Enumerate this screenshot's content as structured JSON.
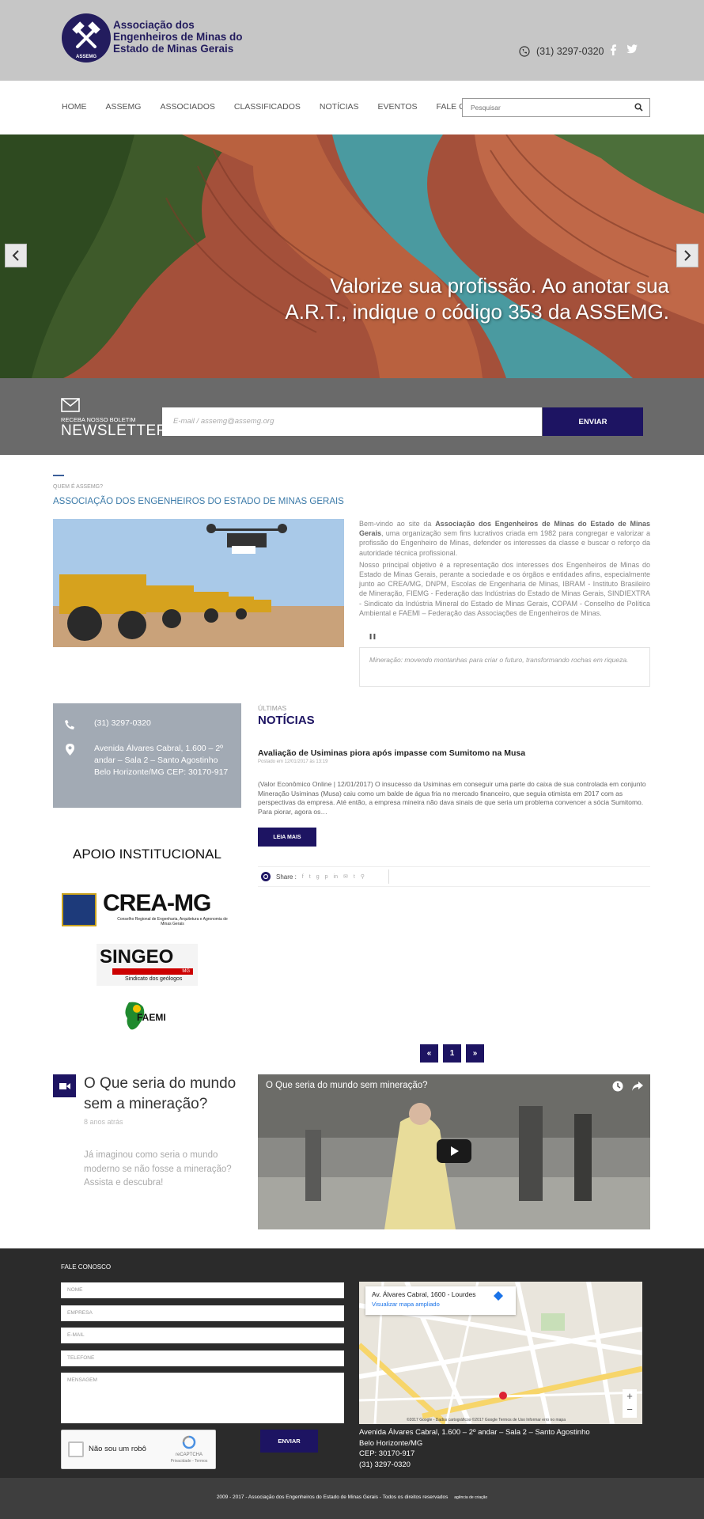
{
  "header": {
    "logo_lines": [
      "Associação dos",
      "Engenheiros de Minas do",
      "Estado de Minas Gerais"
    ],
    "logo_badge_text": "ASSEMG",
    "phone": "(31) 3297-0320"
  },
  "nav": {
    "items": [
      "HOME",
      "ASSEMG",
      "ASSOCIADOS",
      "CLASSIFICADOS",
      "NOTÍCIAS",
      "EVENTOS",
      "FALE CONOSCO"
    ],
    "search_placeholder": "Pesquisar"
  },
  "hero": {
    "caption_line1": "Valorize sua profissão. Ao anotar sua",
    "caption_line2": "A.R.T., indique o código 353 da ASSEMG."
  },
  "newsletter": {
    "small": "RECEBA NOSSO BOLETIM",
    "big": "NEWSLETTER",
    "placeholder": "E-mail / assemg@assemg.org",
    "button": "ENVIAR"
  },
  "about": {
    "subtitle": "QUEM É ASSEMG?",
    "title": "ASSOCIAÇÃO DOS ENGENHEIROS DO ESTADO DE MINAS GERAIS",
    "p1_prefix": "Bem-vindo ao site da ",
    "p1_bold": "Associação dos Engenheiros de Minas do Estado de Minas Gerais",
    "p1_suffix": ", uma organização sem fins lucrativos criada em 1982 para congregar e valorizar a profissão do Engenheiro de Minas, defender os interesses da classe e buscar o reforço da autoridade técnica profissional.",
    "p2": "Nosso principal objetivo é a representação dos interesses dos Engenheiros de Minas do Estado de Minas Gerais, perante a sociedade e os órgãos e entidades afins, especialmente junto ao CREA/MG, DNPM, Escolas de Engenharia de Minas, IBRAM - Instituto Brasileiro de Mineração, FIEMG - Federação das Indústrias do Estado de Minas Gerais, SINDIEXTRA - Sindicato da Indústria Mineral do Estado de Minas Gerais, COPAM - Conselho de Política Ambiental e FAEMI – Federação das Associações de Engenheiros de Minas.",
    "quote": "Mineração: movendo montanhas para criar o futuro, transformando rochas em riqueza."
  },
  "contact_box": {
    "phone": "(31) 3297-0320",
    "address": "Avenida Álvares Cabral, 1.600 – 2º andar – Sala 2 – Santo Agostinho Belo Horizonte/MG CEP: 30170-917"
  },
  "apoio": {
    "title": "APOIO INSTITUCIONAL",
    "crea_name": "CREA-MG",
    "crea_sub": "Conselho Regional de Engenharia, Arquitetura e Agronomia de Minas Gerais",
    "singeo_name": "SINGEO",
    "singeo_mg": "MG",
    "singeo_sub": "Sindicato dos geólogos",
    "faemi": "FAEMI"
  },
  "news": {
    "small": "ÚLTIMAS",
    "big": "NOTÍCIAS",
    "title": "Avaliação de Usiminas piora após impasse com Sumitomo na Musa",
    "date": "Postado em 12/01/2017 às 13:19",
    "body": "(Valor Econômico Online | 12/01/2017) O insucesso da Usiminas em conseguir uma parte do caixa de sua controlada em conjunto Mineração Usiminas (Musa) caiu como um balde de água fria no mercado financeiro, que seguia otimista em 2017 com as perspectivas da empresa. Até então, a empresa mineira não dava sinais de que seria um problema convencer a sócia Sumitomo. Para piorar, agora os…",
    "read_more": "LEIA MAIS",
    "share_label": "Share :",
    "pager": [
      "«",
      "1",
      "»"
    ]
  },
  "video": {
    "title": "O Que seria do mundo sem a mineração?",
    "ago": "8 anos atrás",
    "desc": "Já imaginou como seria o mundo moderno se não fosse a mineração? Assista e descubra!",
    "player_title": "O Que seria do mundo sem mineração?"
  },
  "footer": {
    "title": "FALE CONOSCO",
    "fields": [
      "NOME",
      "EMPRESA",
      "E-MAIL",
      "TELEFONE"
    ],
    "message": "MENSAGEM",
    "captcha": "Não sou um robô",
    "captcha_brand": "reCAPTCHA",
    "captcha_links": "Privacidade - Termos",
    "send": "ENVIAR",
    "map_addr": "Av. Álvares Cabral, 1600 - Lourdes",
    "map_link": "Visualizar mapa ampliado",
    "map_credit": "©2017 Google - Dados cartográficos ©2017 Google   Termos de Uso   Informar erro no mapa",
    "addr1": "Avenida Álvares Cabral, 1.600 – 2º andar – Sala 2 – Santo Agostinho",
    "addr2": "Belo Horizonte/MG",
    "addr3": "CEP: 30170-917",
    "addr4": "(31) 3297-0320",
    "copyright": "2009 - 2017 - Associação dos Engenheiros do Estado de Minas Gerais - Todos os direitos reservados",
    "agency": "agência de criação"
  },
  "colors": {
    "brand_navy": "#1d1462",
    "topbar": "#c6c6c6",
    "footer": "#2b2b2b"
  }
}
